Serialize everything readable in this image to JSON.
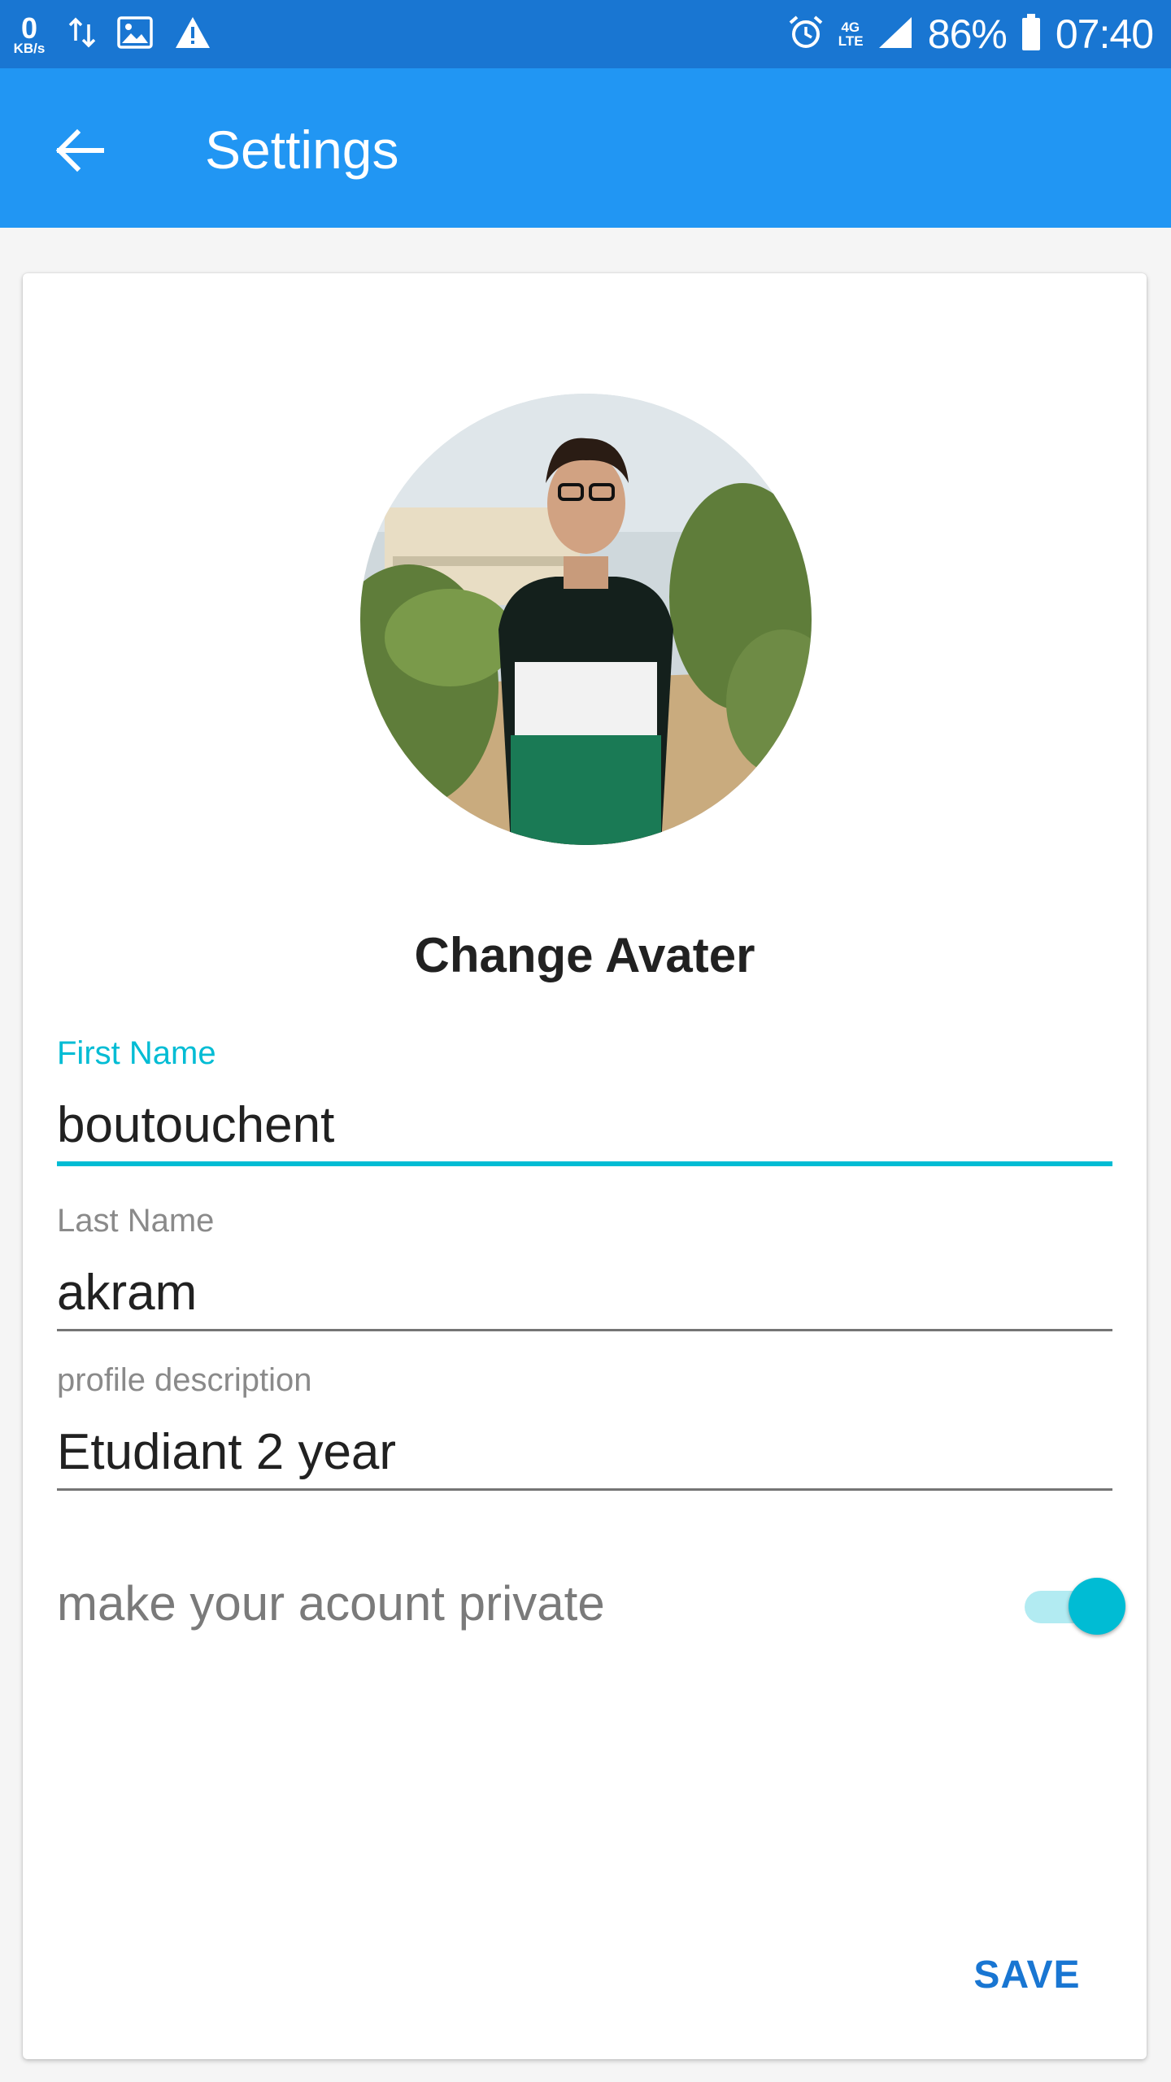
{
  "status_bar": {
    "net_speed_value": "0",
    "net_speed_unit": "KB/s",
    "network_type": "4G LTE",
    "battery": "86%",
    "time": "07:40",
    "icons": [
      "data-transfer-icon",
      "image-icon",
      "warning-icon",
      "alarm-icon",
      "lte-icon",
      "signal-icon",
      "battery-icon"
    ]
  },
  "app_bar": {
    "title": "Settings",
    "back_icon": "arrow-left-icon",
    "color": "#2196F3"
  },
  "profile": {
    "avatar_alt": "profile avatar photo",
    "change_avatar_label": "Change Avater"
  },
  "form": {
    "first_name": {
      "label": "First Name",
      "value": "boutouchent"
    },
    "last_name": {
      "label": "Last Name",
      "value": "akram"
    },
    "description": {
      "label": "profile description",
      "value": "Etudiant 2 year"
    },
    "private_label": "make your acount private",
    "private_enabled": true,
    "accent_color": "#00BCD4"
  },
  "actions": {
    "save_label": "SAVE",
    "save_color": "#1976D2"
  }
}
